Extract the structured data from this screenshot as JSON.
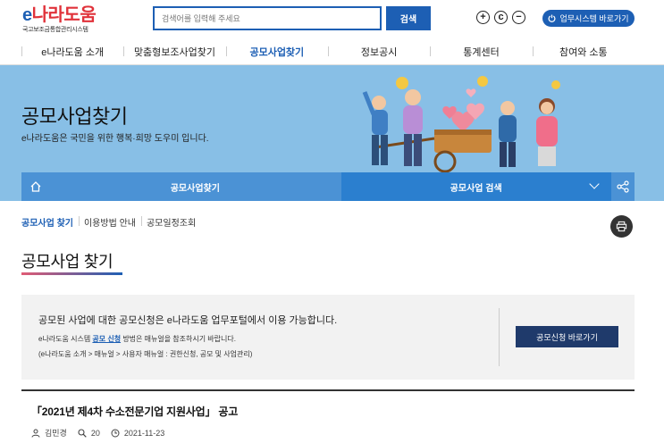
{
  "header": {
    "logo_main_e": "e",
    "logo_main_rest": "나라도움",
    "logo_sub": "국고보조금통합관리시스템",
    "search_placeholder": "검색어를 입력해 주세요",
    "search_button": "검색",
    "zoom_in": "+",
    "zoom_reset": "c",
    "zoom_out": "−",
    "portal_button": "업무시스템 바로가기"
  },
  "gnb": [
    "e나라도움 소개",
    "맞춤형보조사업찾기",
    "공모사업찾기",
    "정보공시",
    "통계센터",
    "참여와 소통"
  ],
  "gnb_active_index": 2,
  "banner": {
    "title": "공모사업찾기",
    "desc": "e나라도움은 국민을 위한 행복·희망 도우미 입니다."
  },
  "subnav": {
    "current": "공모사업찾기",
    "select": "공모사업 검색"
  },
  "tabs": [
    "공모사업 찾기",
    "이용방법 안내",
    "공모일정조회"
  ],
  "page_title": "공모사업 찾기",
  "info": {
    "line1": "공모된 사업에 대한 공모신청은 e나라도움 업무포털에서 이용 가능합니다.",
    "line2_pre": "e나라도움 시스템 ",
    "line2_link": "공모 신청",
    "line2_post": " 방법은 매뉴얼을 참조하시기 바랍니다.",
    "line3": "(e나라도움 소개 > 매뉴얼 > 사용자 매뉴얼 : 권한신청, 공모 및 사업관리)",
    "button": "공모신청 바로가기"
  },
  "notice": {
    "title": "「2021년 제4차 수소전문기업 지원사업」 공고",
    "author": "김민경",
    "views": "20",
    "date": "2021-11-23"
  },
  "colors": {
    "primary": "#1d5fb4",
    "banner_bg": "#88bfe6",
    "subnav": "#4b92d5",
    "apply_button": "#1f3a6b"
  }
}
